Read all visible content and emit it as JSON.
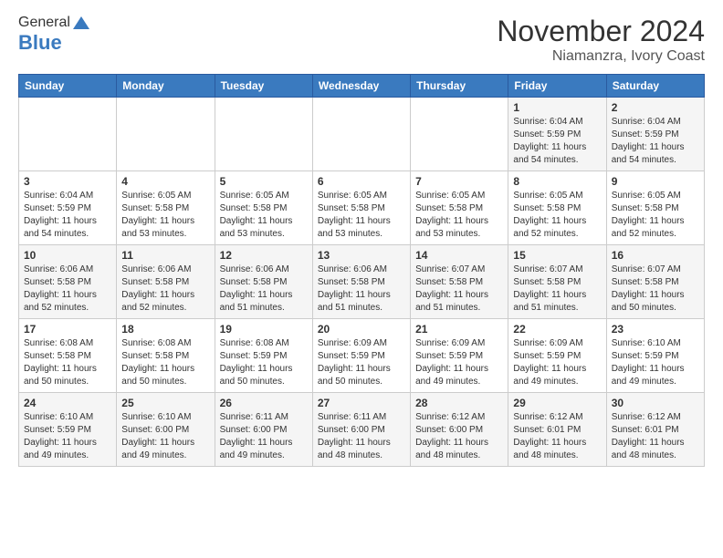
{
  "header": {
    "logo": {
      "general": "General",
      "blue": "Blue"
    },
    "title": "November 2024",
    "location": "Niamanzra, Ivory Coast"
  },
  "weekdays": [
    "Sunday",
    "Monday",
    "Tuesday",
    "Wednesday",
    "Thursday",
    "Friday",
    "Saturday"
  ],
  "weeks": [
    [
      {
        "day": "",
        "info": ""
      },
      {
        "day": "",
        "info": ""
      },
      {
        "day": "",
        "info": ""
      },
      {
        "day": "",
        "info": ""
      },
      {
        "day": "",
        "info": ""
      },
      {
        "day": "1",
        "info": "Sunrise: 6:04 AM\nSunset: 5:59 PM\nDaylight: 11 hours\nand 54 minutes."
      },
      {
        "day": "2",
        "info": "Sunrise: 6:04 AM\nSunset: 5:59 PM\nDaylight: 11 hours\nand 54 minutes."
      }
    ],
    [
      {
        "day": "3",
        "info": "Sunrise: 6:04 AM\nSunset: 5:59 PM\nDaylight: 11 hours\nand 54 minutes."
      },
      {
        "day": "4",
        "info": "Sunrise: 6:05 AM\nSunset: 5:58 PM\nDaylight: 11 hours\nand 53 minutes."
      },
      {
        "day": "5",
        "info": "Sunrise: 6:05 AM\nSunset: 5:58 PM\nDaylight: 11 hours\nand 53 minutes."
      },
      {
        "day": "6",
        "info": "Sunrise: 6:05 AM\nSunset: 5:58 PM\nDaylight: 11 hours\nand 53 minutes."
      },
      {
        "day": "7",
        "info": "Sunrise: 6:05 AM\nSunset: 5:58 PM\nDaylight: 11 hours\nand 53 minutes."
      },
      {
        "day": "8",
        "info": "Sunrise: 6:05 AM\nSunset: 5:58 PM\nDaylight: 11 hours\nand 52 minutes."
      },
      {
        "day": "9",
        "info": "Sunrise: 6:05 AM\nSunset: 5:58 PM\nDaylight: 11 hours\nand 52 minutes."
      }
    ],
    [
      {
        "day": "10",
        "info": "Sunrise: 6:06 AM\nSunset: 5:58 PM\nDaylight: 11 hours\nand 52 minutes."
      },
      {
        "day": "11",
        "info": "Sunrise: 6:06 AM\nSunset: 5:58 PM\nDaylight: 11 hours\nand 52 minutes."
      },
      {
        "day": "12",
        "info": "Sunrise: 6:06 AM\nSunset: 5:58 PM\nDaylight: 11 hours\nand 51 minutes."
      },
      {
        "day": "13",
        "info": "Sunrise: 6:06 AM\nSunset: 5:58 PM\nDaylight: 11 hours\nand 51 minutes."
      },
      {
        "day": "14",
        "info": "Sunrise: 6:07 AM\nSunset: 5:58 PM\nDaylight: 11 hours\nand 51 minutes."
      },
      {
        "day": "15",
        "info": "Sunrise: 6:07 AM\nSunset: 5:58 PM\nDaylight: 11 hours\nand 51 minutes."
      },
      {
        "day": "16",
        "info": "Sunrise: 6:07 AM\nSunset: 5:58 PM\nDaylight: 11 hours\nand 50 minutes."
      }
    ],
    [
      {
        "day": "17",
        "info": "Sunrise: 6:08 AM\nSunset: 5:58 PM\nDaylight: 11 hours\nand 50 minutes."
      },
      {
        "day": "18",
        "info": "Sunrise: 6:08 AM\nSunset: 5:58 PM\nDaylight: 11 hours\nand 50 minutes."
      },
      {
        "day": "19",
        "info": "Sunrise: 6:08 AM\nSunset: 5:59 PM\nDaylight: 11 hours\nand 50 minutes."
      },
      {
        "day": "20",
        "info": "Sunrise: 6:09 AM\nSunset: 5:59 PM\nDaylight: 11 hours\nand 50 minutes."
      },
      {
        "day": "21",
        "info": "Sunrise: 6:09 AM\nSunset: 5:59 PM\nDaylight: 11 hours\nand 49 minutes."
      },
      {
        "day": "22",
        "info": "Sunrise: 6:09 AM\nSunset: 5:59 PM\nDaylight: 11 hours\nand 49 minutes."
      },
      {
        "day": "23",
        "info": "Sunrise: 6:10 AM\nSunset: 5:59 PM\nDaylight: 11 hours\nand 49 minutes."
      }
    ],
    [
      {
        "day": "24",
        "info": "Sunrise: 6:10 AM\nSunset: 5:59 PM\nDaylight: 11 hours\nand 49 minutes."
      },
      {
        "day": "25",
        "info": "Sunrise: 6:10 AM\nSunset: 6:00 PM\nDaylight: 11 hours\nand 49 minutes."
      },
      {
        "day": "26",
        "info": "Sunrise: 6:11 AM\nSunset: 6:00 PM\nDaylight: 11 hours\nand 49 minutes."
      },
      {
        "day": "27",
        "info": "Sunrise: 6:11 AM\nSunset: 6:00 PM\nDaylight: 11 hours\nand 48 minutes."
      },
      {
        "day": "28",
        "info": "Sunrise: 6:12 AM\nSunset: 6:00 PM\nDaylight: 11 hours\nand 48 minutes."
      },
      {
        "day": "29",
        "info": "Sunrise: 6:12 AM\nSunset: 6:01 PM\nDaylight: 11 hours\nand 48 minutes."
      },
      {
        "day": "30",
        "info": "Sunrise: 6:12 AM\nSunset: 6:01 PM\nDaylight: 11 hours\nand 48 minutes."
      }
    ]
  ]
}
